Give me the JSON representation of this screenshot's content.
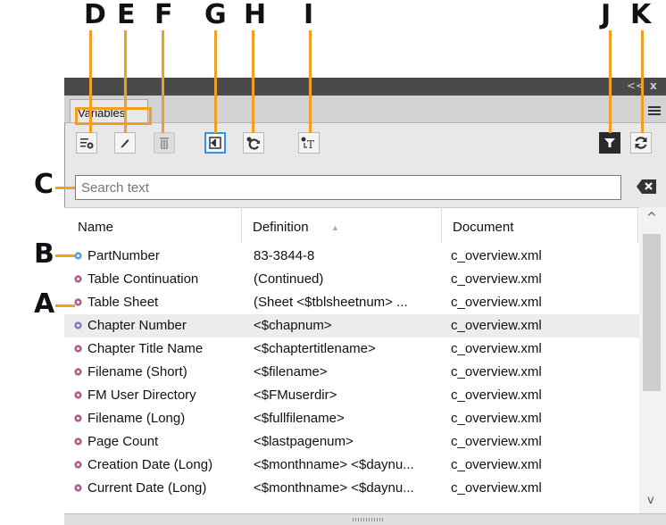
{
  "callouts": {
    "D": "D",
    "E": "E",
    "F": "F",
    "G": "G",
    "H": "H",
    "I": "I",
    "J": "J",
    "K": "K",
    "C": "C",
    "B": "B",
    "A": "A"
  },
  "panel": {
    "title_controls": {
      "collapse": "<<",
      "close": "x"
    },
    "tab_label": "Variables",
    "toolbar_icons": [
      "insert-variable-icon",
      "edit-variable-icon",
      "delete-variable-icon",
      "convert-to-text-icon",
      "update-variables-icon",
      "convert-table-to-text-icon",
      "filter-icon",
      "refresh-icon"
    ],
    "search_placeholder": "Search text",
    "columns": {
      "name": "Name",
      "definition": "Definition",
      "document": "Document"
    },
    "sort_indicator": "▲",
    "rows": [
      {
        "name": "PartNumber",
        "definition": "83-3844-8",
        "document": "c_overview.xml",
        "icon_color": "#5aa0d8"
      },
      {
        "name": "Table Continuation",
        "definition": "(Continued)",
        "document": "c_overview.xml",
        "icon_color": "#b05d8c"
      },
      {
        "name": "Table Sheet",
        "definition": "(Sheet <$tblsheetnum> ...",
        "document": "c_overview.xml",
        "icon_color": "#b05d8c"
      },
      {
        "name": "Chapter Number",
        "definition": "<$chapnum>",
        "document": "c_overview.xml",
        "icon_color": "#8a7ab8"
      },
      {
        "name": "Chapter Title Name",
        "definition": "<$chaptertitlename>",
        "document": "c_overview.xml",
        "icon_color": "#b05d8c"
      },
      {
        "name": "Filename (Short)",
        "definition": "<$filename>",
        "document": "c_overview.xml",
        "icon_color": "#b05d8c"
      },
      {
        "name": "FM User Directory",
        "definition": "<$FMuserdir>",
        "document": "c_overview.xml",
        "icon_color": "#b05d8c"
      },
      {
        "name": "Filename (Long)",
        "definition": "<$fullfilename>",
        "document": "c_overview.xml",
        "icon_color": "#b05d8c"
      },
      {
        "name": "Page Count",
        "definition": "<$lastpagenum>",
        "document": "c_overview.xml",
        "icon_color": "#b05d8c"
      },
      {
        "name": "Creation Date (Long)",
        "definition": "<$monthname> <$daynu...",
        "document": "c_overview.xml",
        "icon_color": "#b05d8c"
      },
      {
        "name": "Current Date (Long)",
        "definition": "<$monthname> <$daynu...",
        "document": "c_overview.xml",
        "icon_color": "#b05d8c"
      }
    ],
    "scroll": {
      "up": "^",
      "down": "v"
    },
    "colors": {
      "accent_leader": "#f0a020",
      "selection_blue": "#3a8ee6"
    }
  }
}
